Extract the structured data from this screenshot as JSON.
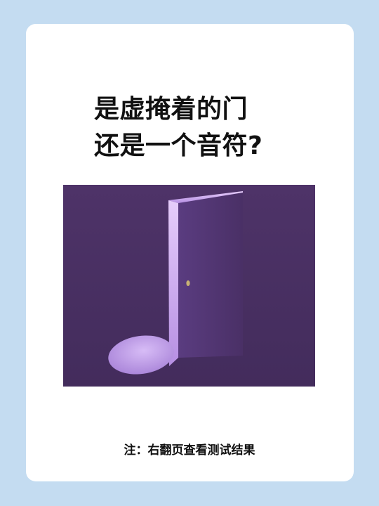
{
  "title": {
    "line1": "是虚掩着的门",
    "line2": "还是一个音符?"
  },
  "illustration": {
    "description_icon": "music-note-door-icon",
    "background_color": "#4b3166",
    "light_color": "#c9a8ee"
  },
  "footer": {
    "note": "注：右翻页查看测试结果"
  }
}
